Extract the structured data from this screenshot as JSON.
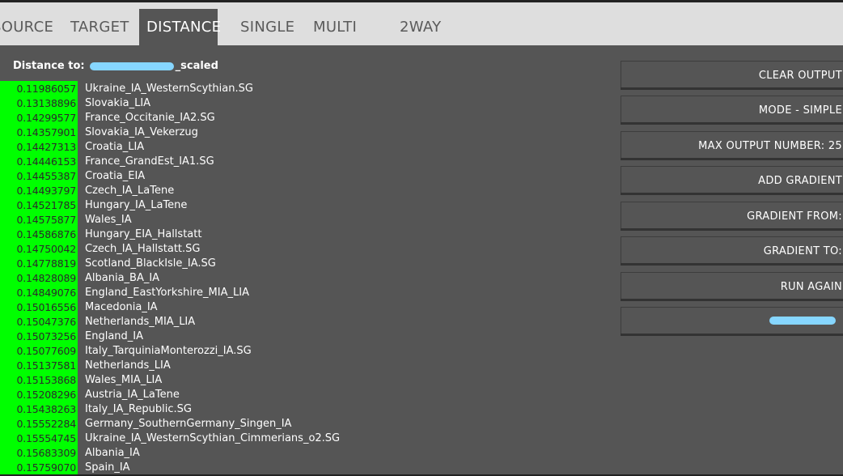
{
  "tabs": [
    {
      "label": "SOURCE",
      "active": false
    },
    {
      "label": "TARGET",
      "active": false
    },
    {
      "label": "DISTANCE",
      "active": true
    },
    {
      "label": "SINGLE",
      "active": false
    },
    {
      "label": "MULTI",
      "active": false
    },
    {
      "label": "2WAY",
      "active": false
    }
  ],
  "distance": {
    "label": "Distance to:",
    "target_suffix": "_scaled"
  },
  "results": [
    {
      "value": "0.11986057",
      "name": "Ukraine_IA_WesternScythian.SG"
    },
    {
      "value": "0.13138896",
      "name": "Slovakia_LIA"
    },
    {
      "value": "0.14299577",
      "name": "France_Occitanie_IA2.SG"
    },
    {
      "value": "0.14357901",
      "name": "Slovakia_IA_Vekerzug"
    },
    {
      "value": "0.14427313",
      "name": "Croatia_LIA"
    },
    {
      "value": "0.14446153",
      "name": "France_GrandEst_IA1.SG"
    },
    {
      "value": "0.14455387",
      "name": "Croatia_EIA"
    },
    {
      "value": "0.14493797",
      "name": "Czech_IA_LaTene"
    },
    {
      "value": "0.14521785",
      "name": "Hungary_IA_LaTene"
    },
    {
      "value": "0.14575877",
      "name": "Wales_IA"
    },
    {
      "value": "0.14586876",
      "name": "Hungary_EIA_Hallstatt"
    },
    {
      "value": "0.14750042",
      "name": "Czech_IA_Hallstatt.SG"
    },
    {
      "value": "0.14778819",
      "name": "Scotland_BlackIsle_IA.SG"
    },
    {
      "value": "0.14828089",
      "name": "Albania_BA_IA"
    },
    {
      "value": "0.14849076",
      "name": "England_EastYorkshire_MIA_LIA"
    },
    {
      "value": "0.15016556",
      "name": "Macedonia_IA"
    },
    {
      "value": "0.15047376",
      "name": "Netherlands_MIA_LIA"
    },
    {
      "value": "0.15073256",
      "name": "England_IA"
    },
    {
      "value": "0.15077609",
      "name": "Italy_TarquiniaMonterozzi_IA.SG"
    },
    {
      "value": "0.15137581",
      "name": "Netherlands_LIA"
    },
    {
      "value": "0.15153868",
      "name": "Wales_MIA_LIA"
    },
    {
      "value": "0.15208296",
      "name": "Austria_IA_LaTene"
    },
    {
      "value": "0.15438263",
      "name": "Italy_IA_Republic.SG"
    },
    {
      "value": "0.15552284",
      "name": "Germany_SouthernGermany_Singen_IA"
    },
    {
      "value": "0.15554745",
      "name": "Ukraine_IA_WesternScythian_Cimmerians_o2.SG"
    },
    {
      "value": "0.15683309",
      "name": "Albania_IA"
    },
    {
      "value": "0.15759070",
      "name": "Spain_IA"
    }
  ],
  "buttons": [
    {
      "label": "CLEAR OUTPUT"
    },
    {
      "label": "MODE - SIMPLE"
    },
    {
      "label": "MAX OUTPUT NUMBER: 25"
    },
    {
      "label": "ADD GRADIENT"
    },
    {
      "label": "GRADIENT FROM:"
    },
    {
      "label": "GRADIENT TO:"
    },
    {
      "label": "RUN AGAIN"
    },
    {
      "label": ""
    }
  ],
  "colors": {
    "background": "#555555",
    "tabbar": "#dedede",
    "distance_column": "#00ff00",
    "redaction": "#86d6ff"
  }
}
